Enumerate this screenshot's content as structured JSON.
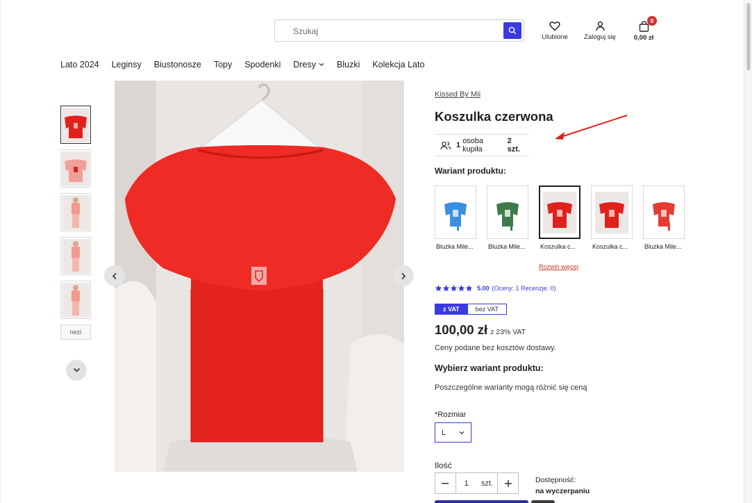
{
  "header": {
    "search_placeholder": "Szukaj",
    "favorites_label": "Ulubione",
    "login_label": "Zaloguj się",
    "cart_count": "0",
    "cart_total": "0,00 zł"
  },
  "nav": {
    "items": [
      "Lato 2024",
      "Leginsy",
      "Biustonosze",
      "Topy",
      "Spodenki",
      "Dresy",
      "Bluzki",
      "Kolekcja Lato"
    ]
  },
  "gallery": {
    "partial_thumb_label": "nezi"
  },
  "product": {
    "brand": "Kissed By Mii",
    "title": "Koszulka czerwona",
    "bought_count": "1",
    "bought_text": "osoba kupiła",
    "bought_qty": "2 szt.",
    "variant_heading": "Wariant produktu:",
    "variants": [
      {
        "name": "Bluzka Mile...",
        "color": "#3b8fe0"
      },
      {
        "name": "Bluzka Mile...",
        "color": "#3e7a4a"
      },
      {
        "name": "Koszulka c...",
        "color": "#e0201c"
      },
      {
        "name": "Koszulka c...",
        "color": "#e0201c"
      },
      {
        "name": "Bluzka Mile...",
        "color": "#e43c34"
      }
    ],
    "more_variants": "Rozwiń więcej",
    "rating_value": "5.00",
    "rating_meta": "(Oceny: 1 Recenzje: 0)",
    "rating_stars": 5,
    "vat_on": "z VAT",
    "vat_off": "bez VAT",
    "price": "100,00 zł",
    "price_vat_note": "z 23% VAT",
    "price_note": "Ceny podane bez kosztów dostawy.",
    "choose_variant": "Wybierz wariant produktu:",
    "variant_price_note": "Poszczególne warianty mogą różnić się ceną",
    "size_label": "*Rozmiar",
    "size_value": "L",
    "qty_label": "Ilość",
    "qty_value": "1",
    "qty_unit": "szt.",
    "availability_label": "Dostępność:",
    "availability_status": "na wyczerpaniu"
  },
  "colors": {
    "accent": "#3a3ae0",
    "product_red": "#e0201c",
    "badge": "#d23030"
  }
}
